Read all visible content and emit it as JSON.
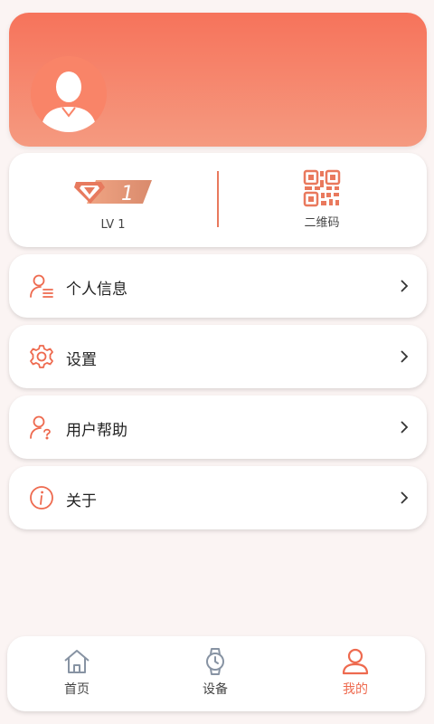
{
  "profile": {
    "level_label": "LV 1",
    "level_badge_number": "1",
    "qr_label": "二维码"
  },
  "menu": [
    {
      "label": "个人信息",
      "icon": "user-list-icon"
    },
    {
      "label": "设置",
      "icon": "gear-icon"
    },
    {
      "label": "用户帮助",
      "icon": "user-help-icon"
    },
    {
      "label": "关于",
      "icon": "info-icon"
    }
  ],
  "tabs": [
    {
      "label": "首页",
      "icon": "home-icon",
      "active": false
    },
    {
      "label": "设备",
      "icon": "watch-icon",
      "active": false
    },
    {
      "label": "我的",
      "icon": "user-icon",
      "active": true
    }
  ],
  "colors": {
    "accent": "#ee6a4f",
    "header_top": "#f6735b",
    "header_bottom": "#f59a80",
    "background": "#fbf4f3"
  }
}
